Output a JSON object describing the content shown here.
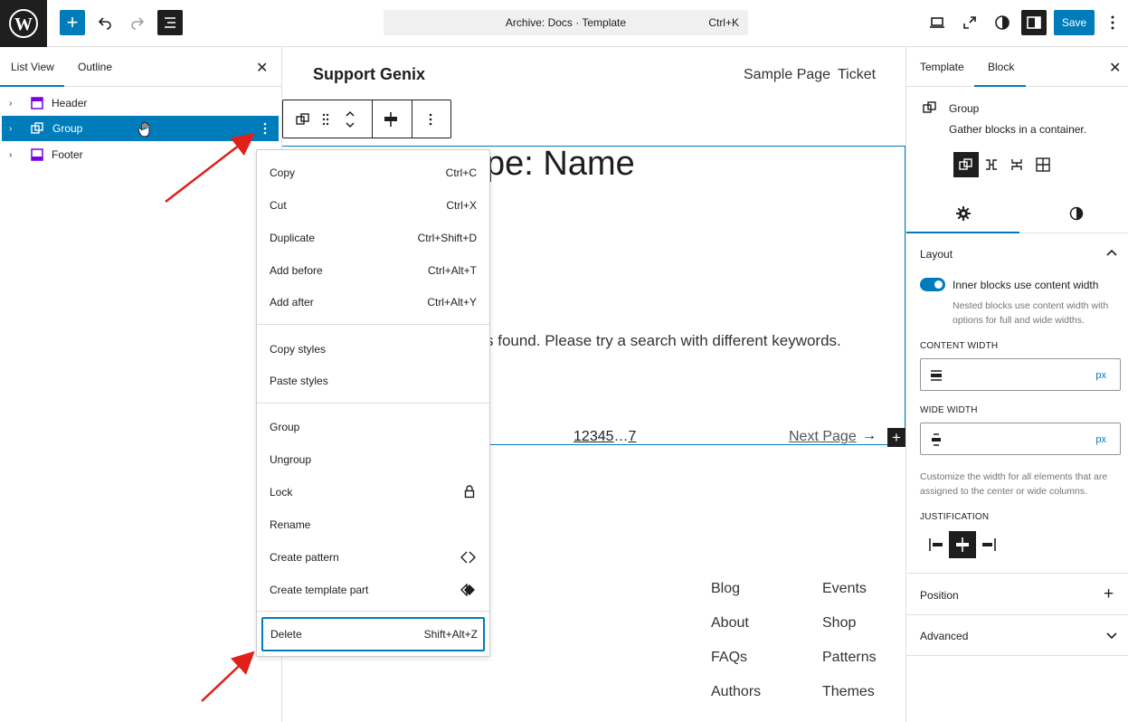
{
  "topbar": {
    "add_label": "+",
    "command": "Archive: Docs · Template",
    "command_shortcut": "Ctrl+K",
    "save_label": "Save"
  },
  "left_panel": {
    "tabs": [
      "List View",
      "Outline"
    ],
    "items": [
      {
        "label": "Header",
        "icon": "template-part-icon"
      },
      {
        "label": "Group",
        "icon": "group-icon"
      },
      {
        "label": "Footer",
        "icon": "template-part-icon"
      }
    ]
  },
  "canvas": {
    "site_title": "Support Genix",
    "nav": [
      "Sample Page",
      "Ticket"
    ],
    "heading": "pe: Name",
    "message": "s found. Please try a search with different keywords.",
    "pagination": [
      "1",
      "2",
      "3",
      "4",
      "5",
      "…",
      "7"
    ],
    "next_page": "Next Page",
    "next_arrow": "→",
    "footer_links_col1": [
      "Blog",
      "About",
      "FAQs",
      "Authors"
    ],
    "footer_links_col2": [
      "Events",
      "Shop",
      "Patterns",
      "Themes"
    ]
  },
  "context_menu": {
    "groups": [
      [
        {
          "label": "Copy",
          "shortcut": "Ctrl+C"
        },
        {
          "label": "Cut",
          "shortcut": "Ctrl+X"
        },
        {
          "label": "Duplicate",
          "shortcut": "Ctrl+Shift+D"
        },
        {
          "label": "Add before",
          "shortcut": "Ctrl+Alt+T"
        },
        {
          "label": "Add after",
          "shortcut": "Ctrl+Alt+Y"
        }
      ],
      [
        {
          "label": "Copy styles",
          "shortcut": ""
        },
        {
          "label": "Paste styles",
          "shortcut": ""
        }
      ],
      [
        {
          "label": "Group",
          "shortcut": ""
        },
        {
          "label": "Ungroup",
          "shortcut": ""
        },
        {
          "label": "Lock",
          "shortcut": "",
          "icon": "lock-icon"
        },
        {
          "label": "Rename",
          "shortcut": ""
        },
        {
          "label": "Create pattern",
          "shortcut": "",
          "icon": "pattern-icon"
        },
        {
          "label": "Create template part",
          "shortcut": "",
          "icon": "template-part-diamond-icon"
        }
      ],
      [
        {
          "label": "Delete",
          "shortcut": "Shift+Alt+Z"
        }
      ]
    ]
  },
  "right_panel": {
    "tabs": [
      "Template",
      "Block"
    ],
    "block_title": "Group",
    "block_desc": "Gather blocks in a container.",
    "layout_title": "Layout",
    "toggle_label": "Inner blocks use content width",
    "toggle_help": "Nested blocks use content width with options for full and wide widths.",
    "toggle_on": true,
    "content_width_label": "CONTENT WIDTH",
    "wide_width_label": "WIDE WIDTH",
    "unit": "px",
    "width_help": "Customize the width for all elements that are assigned to the center or wide columns.",
    "justification_label": "JUSTIFICATION",
    "position_label": "Position",
    "advanced_label": "Advanced"
  },
  "colors": {
    "accent": "#007cba",
    "dark": "#1e1e1e",
    "arrow": "#e0201b",
    "purple_icon": "#7a00df"
  }
}
